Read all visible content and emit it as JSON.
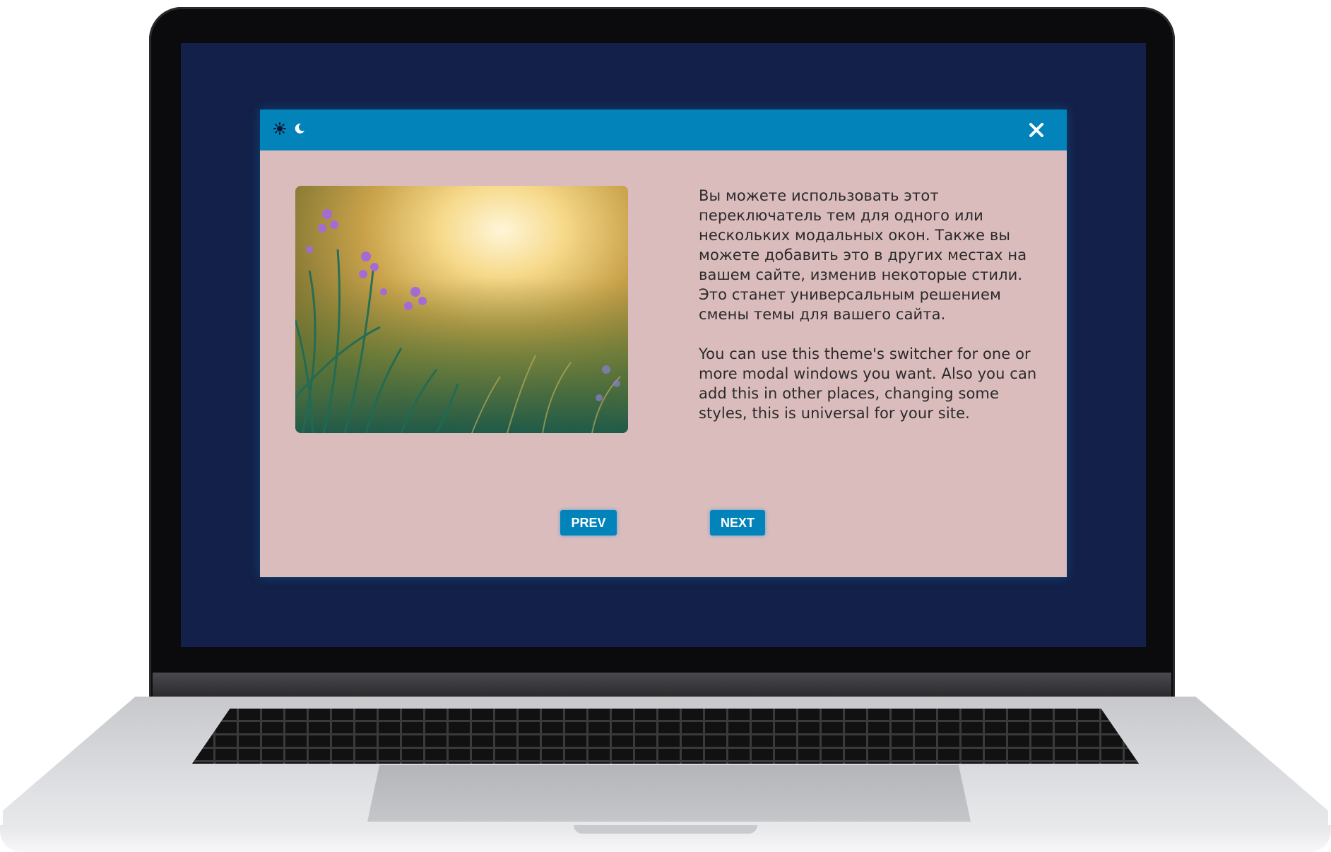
{
  "modal": {
    "header_color": "#0283b9",
    "body_color": "#dbbcbd",
    "icons": {
      "light_theme": "sun-icon",
      "dark_theme": "moon-icon",
      "close": "close-icon"
    },
    "image": "flowers-meadow-photo",
    "text_ru": "Вы можете использовать этот переключатель тем для одного или нескольких модальных окон. Также вы можете добавить это в других местах на вашем сайте, изменив некоторые стили. Это станет универсальным решением смены темы для вашего сайта.",
    "text_en": "You can use this theme's switcher for one or more modal windows you want. Also you can add this in other places, changing some styles, this is universal for your site.",
    "prev_label": "PREV",
    "next_label": "NEXT"
  },
  "screen_color": "#132049"
}
